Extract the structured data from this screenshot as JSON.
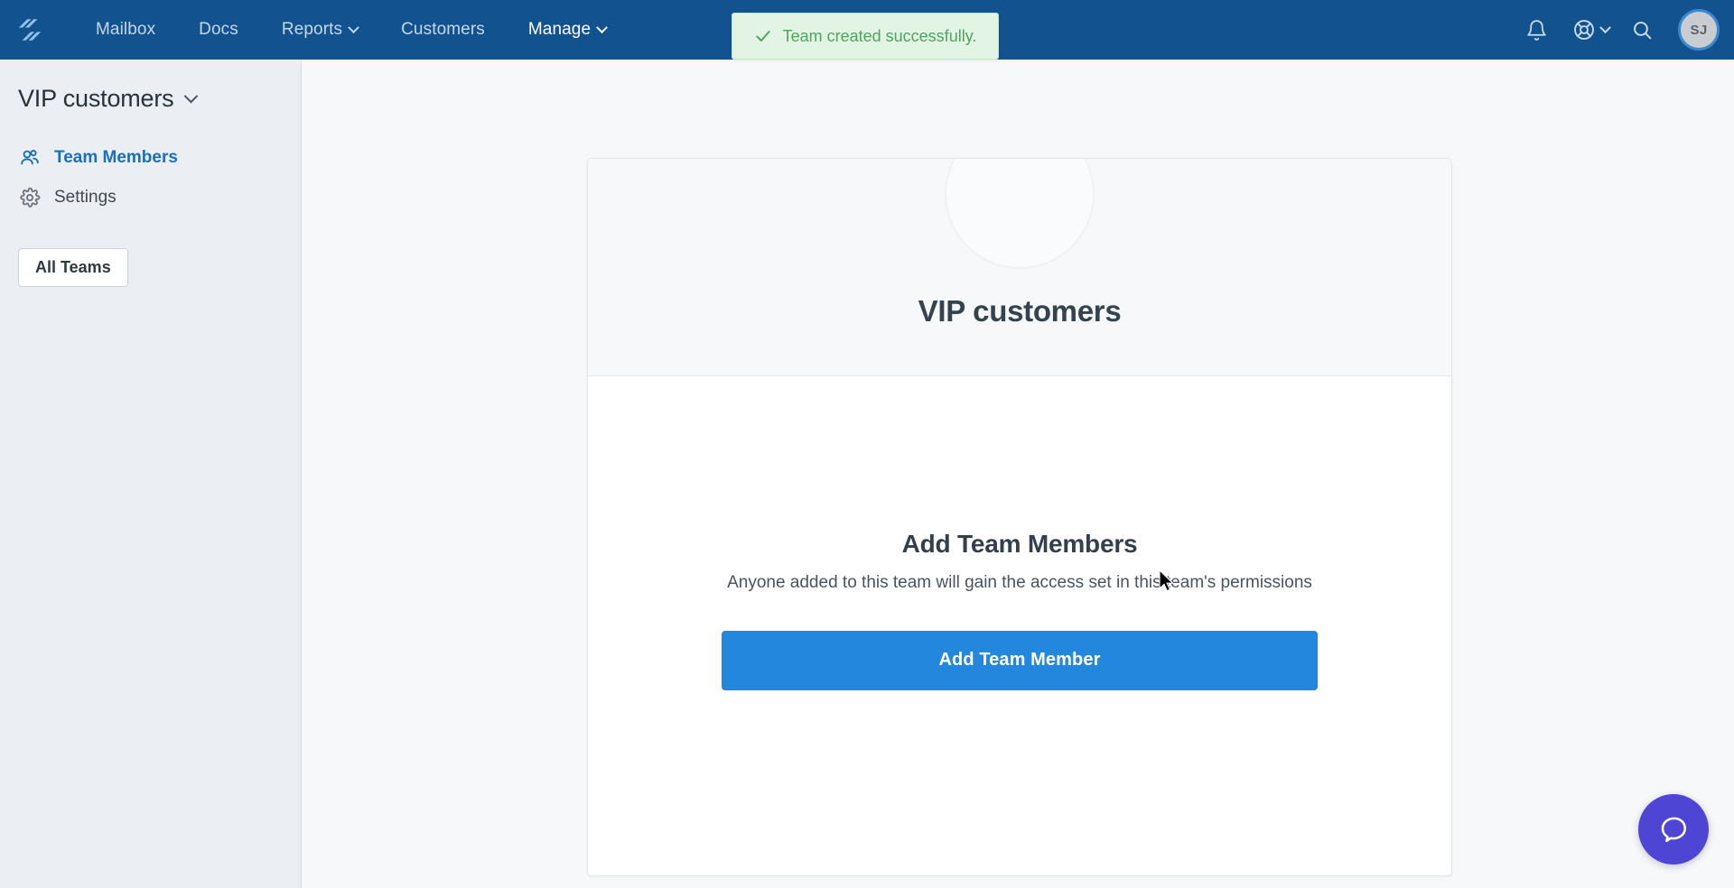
{
  "topnav": {
    "logo_name": "helpscout-logo",
    "links": [
      {
        "label": "Mailbox",
        "has_caret": false,
        "active": false
      },
      {
        "label": "Docs",
        "has_caret": false,
        "active": false
      },
      {
        "label": "Reports",
        "has_caret": true,
        "active": false
      },
      {
        "label": "Customers",
        "has_caret": false,
        "active": false
      },
      {
        "label": "Manage",
        "has_caret": true,
        "active": true
      }
    ],
    "notifications_icon": "bell-icon",
    "help_icon": "lifebuoy-icon",
    "search_icon": "search-icon",
    "avatar_initials": "SJ",
    "brand_color": "#12538f"
  },
  "toast": {
    "message": "Team created successfully.",
    "icon": "check-icon",
    "bg_color": "#e2f5e5",
    "text_color": "#4fa45e"
  },
  "sidebar": {
    "team_name": "VIP customers",
    "team_caret_icon": "chevron-down-icon",
    "items": [
      {
        "label": "Team Members",
        "icon": "people-icon",
        "active": true
      },
      {
        "label": "Settings",
        "icon": "gear-icon",
        "active": false
      }
    ],
    "all_teams_label": "All Teams"
  },
  "main": {
    "card": {
      "avatar_icon": "team-avatar-placeholder",
      "title": "VIP customers",
      "empty_state": {
        "heading": "Add Team Members",
        "description": "Anyone added to this team will gain the access set in this team's permissions",
        "button_label": "Add Team Member",
        "button_color": "#2388dd"
      }
    }
  },
  "chat_widget": {
    "icon": "chat-bubble-icon",
    "color": "#4f45d4"
  }
}
